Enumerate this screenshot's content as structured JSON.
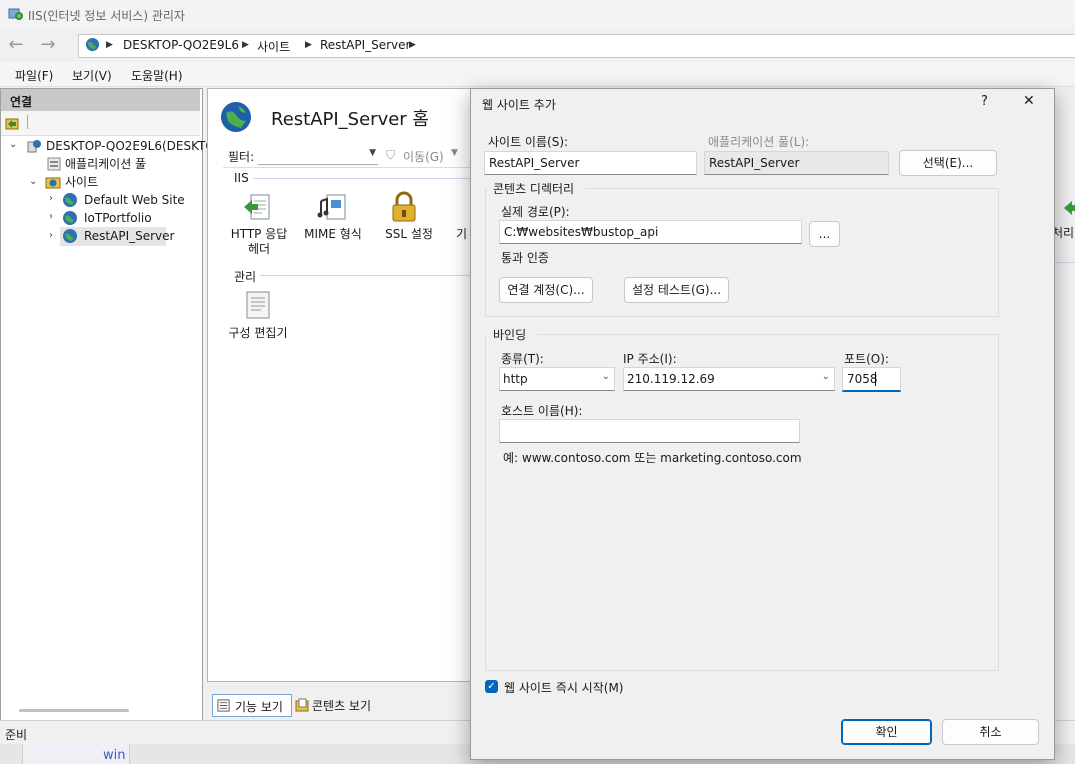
{
  "window": {
    "title": "IIS(인터넷 정보 서비스) 관리자"
  },
  "address": {
    "segments": [
      "DESKTOP-QO2E9L6",
      "사이트",
      "RestAPI_Server"
    ]
  },
  "menu": {
    "items": [
      "파일(F)",
      "보기(V)",
      "도움말(H)"
    ]
  },
  "connections": {
    "header": "연결",
    "tree": {
      "server": "DESKTOP-QO2E9L6(DESKTO",
      "app_pool": "애플리케이션 풀",
      "sites": "사이트",
      "site_items": [
        "Default Web Site",
        "IoTPortfolio",
        "RestAPI_Server"
      ]
    }
  },
  "main": {
    "title": "RestAPI_Server 홈",
    "filter_label": "필터:",
    "go_label": "이동(G)",
    "sections": {
      "iis": "IIS",
      "manage": "관리"
    },
    "features": [
      {
        "label_line1": "HTTP 응답",
        "label_line2": "헤더"
      },
      {
        "label_line1": "MIME 형식",
        "label_line2": ""
      },
      {
        "label_line1": "SSL 설정",
        "label_line2": ""
      },
      {
        "label_line1": "기",
        "label_line2": ""
      }
    ],
    "manage_features": [
      {
        "label": "구성 편집기"
      }
    ],
    "right_cut_label": "처리",
    "tabs": {
      "features_view": "기능 보기",
      "content_view": "콘텐츠 보기"
    }
  },
  "status": {
    "text": "준비",
    "taskbar_text": "win"
  },
  "dialog": {
    "title": "웹 사이트 추가",
    "help": "?",
    "close": "✕",
    "site_name_label": "사이트 이름(S):",
    "site_name_value": "RestAPI_Server",
    "app_pool_label": "애플리케이션 풀(L):",
    "app_pool_value": "RestAPI_Server",
    "select_button": "선택(E)...",
    "content_dir_group": "콘텐츠 디렉터리",
    "physical_path_label": "실제 경로(P):",
    "physical_path_value": "C:₩websites₩bustop_api",
    "browse_button": "...",
    "pass_auth_label": "통과 인증",
    "connect_as_button": "연결 계정(C)...",
    "test_settings_button": "설정 테스트(G)...",
    "binding_group": "바인딩",
    "type_label": "종류(T):",
    "type_value": "http",
    "ip_label": "IP 주소(I):",
    "ip_value": "210.119.12.69",
    "port_label": "포트(O):",
    "port_value": "7058",
    "host_label": "호스트 이름(H):",
    "host_value": "",
    "example_text": "예: www.contoso.com 또는 marketing.contoso.com",
    "start_immediately_label": "웹 사이트 즉시 시작(M)",
    "start_immediately_checked": true,
    "ok_button": "확인",
    "cancel_button": "취소"
  },
  "colors": {
    "accent": "#0067c0",
    "tree_selected": "#e5e5e5",
    "panel_header": "#c8c8c8"
  }
}
